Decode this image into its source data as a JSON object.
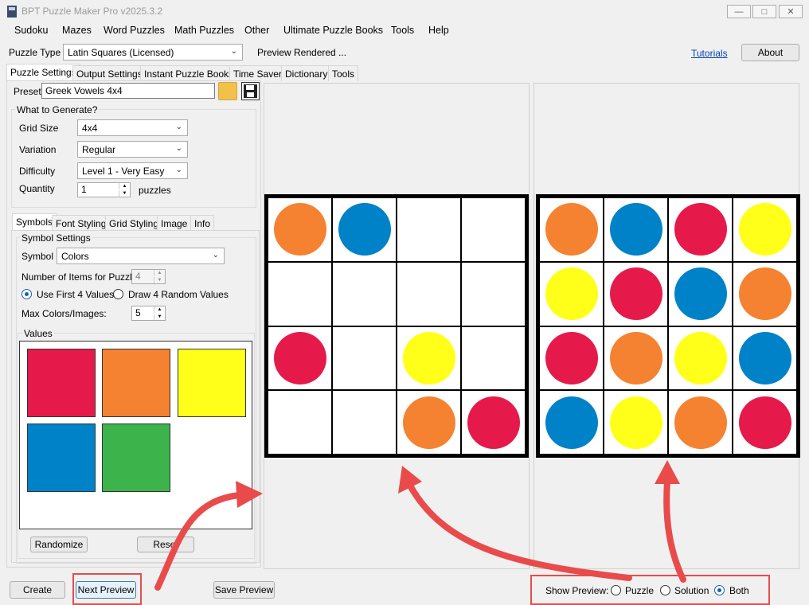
{
  "window": {
    "title": "BPT Puzzle Maker Pro v2025.3.2"
  },
  "menu": [
    "Sudoku",
    "Mazes",
    "Word Puzzles",
    "Math Puzzles",
    "Other",
    "Ultimate Puzzle Books",
    "Tools",
    "Help"
  ],
  "toolbar": {
    "puzzle_type_label": "Puzzle Type",
    "puzzle_type_value": "Latin Squares (Licensed)",
    "status": "Preview Rendered ...",
    "tutorials": "Tutorials",
    "about": "About"
  },
  "main_tabs": [
    "Puzzle Settings",
    "Output Settings",
    "Instant Puzzle Books",
    "Time Saver",
    "Dictionary",
    "Tools"
  ],
  "preset": {
    "label": "Preset",
    "value": "Greek Vowels 4x4"
  },
  "generate": {
    "group_title": "What to Generate?",
    "grid_size_label": "Grid Size",
    "grid_size": "4x4",
    "variation_label": "Variation",
    "variation": "Regular",
    "difficulty_label": "Difficulty",
    "difficulty": "Level 1 - Very Easy",
    "quantity_label": "Quantity",
    "quantity": "1",
    "quantity_unit": "puzzles"
  },
  "sub_tabs": [
    "Symbols",
    "Font Styling",
    "Grid Styling",
    "Image",
    "Info"
  ],
  "symbols": {
    "group_title": "Symbol Settings",
    "symbol_label": "Symbol",
    "symbol_value": "Colors",
    "items_label": "Number of Items for Puzzle:",
    "items_value": "4",
    "use_first": "Use First 4 Values",
    "draw_random": "Draw 4 Random Values",
    "max_label": "Max Colors/Images:",
    "max_value": "5",
    "values_title": "Values",
    "swatches": [
      "#e51a4b",
      "#f58231",
      "#ffff19",
      "#0082c8",
      "#3cb44b"
    ],
    "randomize": "Randomize",
    "reset": "Reset"
  },
  "bottom": {
    "create": "Create",
    "next_preview": "Next Preview",
    "save_preview": "Save Preview",
    "show_preview_label": "Show Preview:",
    "opt_puzzle": "Puzzle",
    "opt_solution": "Solution",
    "opt_both": "Both"
  },
  "colors": {
    "red": "#e51a4b",
    "orange": "#f58231",
    "yellow": "#ffff19",
    "blue": "#0082c8",
    "green": "#3cb44b",
    "annotation": "#e94b4b"
  },
  "puzzle_grid": [
    [
      "orange",
      "blue",
      null,
      null
    ],
    [
      null,
      null,
      null,
      null
    ],
    [
      "red",
      null,
      "yellow",
      null
    ],
    [
      null,
      null,
      "orange",
      "red"
    ]
  ],
  "solution_grid": [
    [
      "orange",
      "blue",
      "red",
      "yellow"
    ],
    [
      "yellow",
      "red",
      "blue",
      "orange"
    ],
    [
      "red",
      "orange",
      "yellow",
      "blue"
    ],
    [
      "blue",
      "yellow",
      "orange",
      "red"
    ]
  ]
}
